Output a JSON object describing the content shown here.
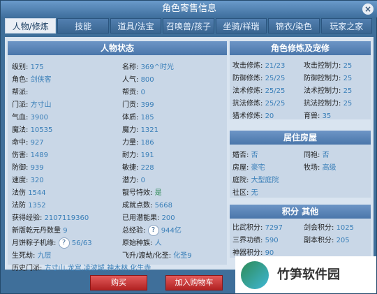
{
  "window": {
    "title": "角色寄售信息",
    "close": "×"
  },
  "tabs": [
    {
      "label": "人物/修炼"
    },
    {
      "label": "技能"
    },
    {
      "label": "道具/法宝"
    },
    {
      "label": "召唤兽/孩子"
    },
    {
      "label": "坐骑/祥瑞"
    },
    {
      "label": "锦衣/染色"
    },
    {
      "label": "玩家之家"
    }
  ],
  "sections": {
    "status": {
      "title": "人物状态"
    },
    "training": {
      "title": "角色修炼及宠修"
    },
    "house": {
      "title": "居住房屋"
    },
    "points": {
      "title": "积分 其他"
    }
  },
  "status": {
    "left": [
      {
        "k": "级别:",
        "v": "175"
      },
      {
        "k": "角色:",
        "v": "剑侠客"
      },
      {
        "k": "帮派:",
        "v": ""
      },
      {
        "k": "门派:",
        "v": "方寸山"
      },
      {
        "k": "气血:",
        "v": "3900"
      },
      {
        "k": "魔法:",
        "v": "10535"
      },
      {
        "k": "命中:",
        "v": "927"
      },
      {
        "k": "伤害:",
        "v": "1489"
      },
      {
        "k": "防御:",
        "v": "939"
      },
      {
        "k": "速度:",
        "v": "320"
      },
      {
        "k": "法伤",
        "v": "1544"
      },
      {
        "k": "法防",
        "v": "1352"
      },
      {
        "k": "获得经验:",
        "v": "2107119360"
      },
      {
        "k": "新版乾元丹数量",
        "v": "9"
      },
      {
        "k": "月饼粽子机缘:",
        "v": "56/63"
      },
      {
        "k": "生死劫:",
        "v": "九层"
      },
      {
        "k": "历史门派:",
        "v": "方寸山,龙宫,凌波城,神木林,化生寺"
      }
    ],
    "right": [
      {
        "k": "名称:",
        "v": "369^时光"
      },
      {
        "k": "人气:",
        "v": "800"
      },
      {
        "k": "帮贡:",
        "v": "0"
      },
      {
        "k": "门贡:",
        "v": "399"
      },
      {
        "k": "体质:",
        "v": "185"
      },
      {
        "k": "魔力:",
        "v": "1321"
      },
      {
        "k": "力量:",
        "v": "186"
      },
      {
        "k": "耐力:",
        "v": "191"
      },
      {
        "k": "敏捷:",
        "v": "228"
      },
      {
        "k": "潜力:",
        "v": "0"
      },
      {
        "k": "靓号特效:",
        "v": "是"
      },
      {
        "k": "成就点数:",
        "v": "5668"
      },
      {
        "k": "已用潜能果:",
        "v": "200"
      },
      {
        "k": "总经验:",
        "v": "944亿"
      },
      {
        "k": "原始种族:",
        "v": "人"
      },
      {
        "k": "飞升/渡劫/化圣:",
        "v": "化圣9"
      }
    ]
  },
  "training": {
    "left": [
      {
        "k": "攻击修炼:",
        "v": "21/23"
      },
      {
        "k": "防御修炼:",
        "v": "25/25"
      },
      {
        "k": "法术修炼:",
        "v": "25/25"
      },
      {
        "k": "抗法修炼:",
        "v": "25/25"
      },
      {
        "k": "猎术修炼:",
        "v": "20"
      }
    ],
    "right": [
      {
        "k": "攻击控制力:",
        "v": "25"
      },
      {
        "k": "防御控制力:",
        "v": "25"
      },
      {
        "k": "法术控制力:",
        "v": "25"
      },
      {
        "k": "抗法控制力:",
        "v": "25"
      },
      {
        "k": "育兽:",
        "v": "35"
      }
    ]
  },
  "house": {
    "left": [
      {
        "k": "婚否:",
        "v": "否"
      },
      {
        "k": "房屋:",
        "v": "豪宅"
      },
      {
        "k": "庭院:",
        "v": "大型庭院"
      },
      {
        "k": "社区:",
        "v": "无"
      }
    ],
    "right": [
      {
        "k": "同袍:",
        "v": "否"
      },
      {
        "k": "牧场:",
        "v": "高级"
      }
    ]
  },
  "points": {
    "left": [
      {
        "k": "比武积分:",
        "v": "7297"
      },
      {
        "k": "三界功绩:",
        "v": "590"
      },
      {
        "k": "神器积分:",
        "v": "90"
      }
    ],
    "right": [
      {
        "k": "剑会积分:",
        "v": "1025"
      },
      {
        "k": "副本积分:",
        "v": "205"
      }
    ]
  },
  "buttons": {
    "buy": "购买",
    "cart": "加入购物车"
  },
  "watermark": {
    "text": "竹笋软件园"
  }
}
